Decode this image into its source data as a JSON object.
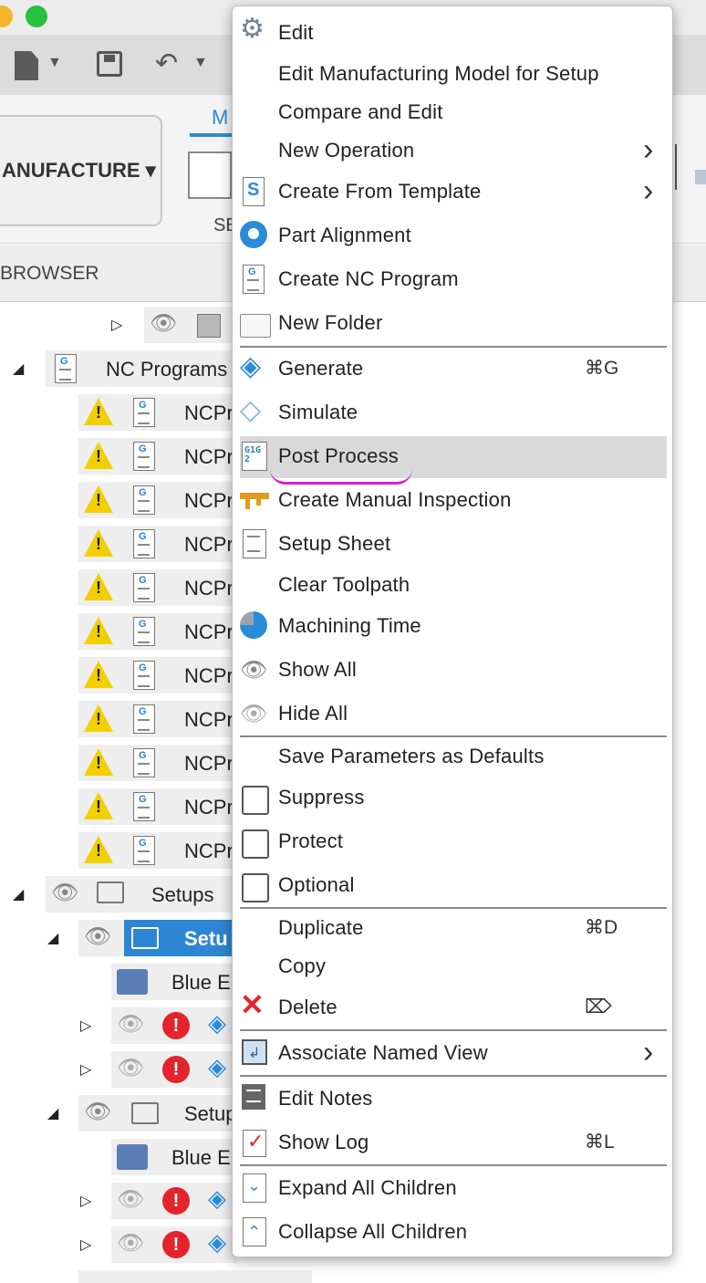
{
  "colors": {
    "accent": "#2a8bd8",
    "warning": "#f2d000",
    "error": "#e5232b",
    "highlight": "#d9d9d9",
    "annotation": "#d61fd6"
  },
  "ribbon": {
    "workspace_label": "ANUFACTURE ▾",
    "tab_label": "M",
    "sub_label": "SE"
  },
  "browser": {
    "header": "BROWSER"
  },
  "tree": {
    "nc_programs": "NC Programs",
    "nc_item": "NCPr",
    "setups": "Setups",
    "setup1": "Setu",
    "blue1": "Blue E",
    "setup2": "Setup",
    "blue2": "Blue E"
  },
  "menu": {
    "items": [
      {
        "label": "Edit"
      },
      {
        "label": "Edit Manufacturing Model for Setup"
      },
      {
        "label": "Compare and Edit"
      },
      {
        "label": "New Operation",
        "submenu": true
      },
      {
        "label": "Create From Template",
        "submenu": true
      },
      {
        "label": "Part Alignment"
      },
      {
        "label": "Create NC Program"
      },
      {
        "label": "New Folder"
      },
      {
        "label": "Generate",
        "shortcut": "⌘G"
      },
      {
        "label": "Simulate"
      },
      {
        "label": "Post Process",
        "highlighted": true
      },
      {
        "label": "Create Manual Inspection"
      },
      {
        "label": "Setup Sheet"
      },
      {
        "label": "Clear Toolpath"
      },
      {
        "label": "Machining Time"
      },
      {
        "label": "Show All"
      },
      {
        "label": "Hide All"
      },
      {
        "label": "Save Parameters as Defaults"
      },
      {
        "label": "Suppress"
      },
      {
        "label": "Protect"
      },
      {
        "label": "Optional"
      },
      {
        "label": "Duplicate",
        "shortcut": "⌘D"
      },
      {
        "label": "Copy"
      },
      {
        "label": "Delete",
        "shortcut": "⌦"
      },
      {
        "label": "Associate Named View",
        "submenu": true
      },
      {
        "label": "Edit Notes"
      },
      {
        "label": "Show Log",
        "shortcut": "⌘L"
      },
      {
        "label": "Expand All Children"
      },
      {
        "label": "Collapse All Children"
      }
    ],
    "g1g2_icon_text": "G1G2"
  }
}
